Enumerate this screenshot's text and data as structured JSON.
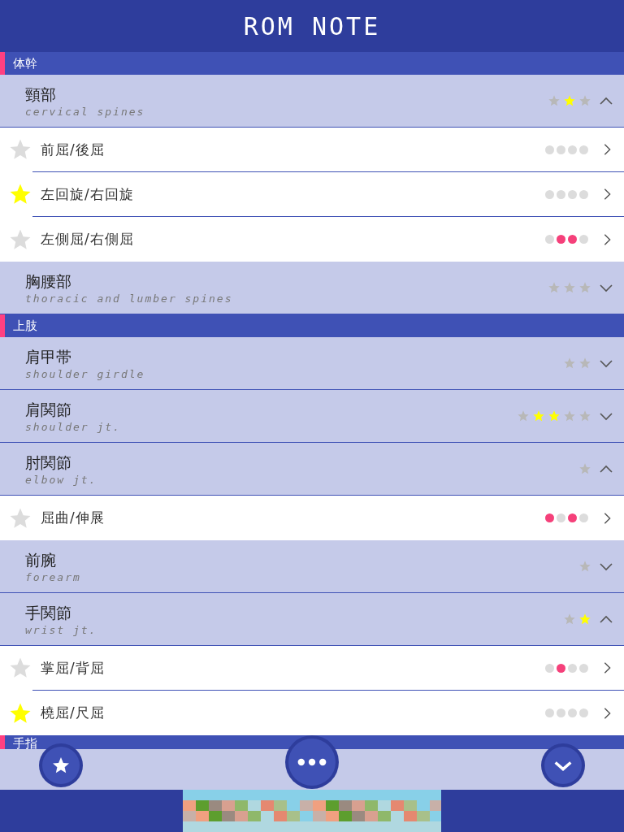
{
  "app_bar": {
    "title": "ROM NOTE"
  },
  "sections": [
    {
      "title": "体幹",
      "groups": [
        {
          "title": "頸部",
          "subtitle": "cervical spines",
          "expanded": true,
          "rating": [
            {
              "on": false
            },
            {
              "on": true
            },
            {
              "on": false
            }
          ],
          "items": [
            {
              "label": "前屈/後屈",
              "favorite": false,
              "dots": [
                {
                  "on": false
                },
                {
                  "on": false
                },
                {
                  "on": false
                },
                {
                  "on": false
                }
              ]
            },
            {
              "label": "左回旋/右回旋",
              "favorite": true,
              "dots": [
                {
                  "on": false
                },
                {
                  "on": false
                },
                {
                  "on": false
                },
                {
                  "on": false
                }
              ]
            },
            {
              "label": "左側屈/右側屈",
              "favorite": false,
              "dots": [
                {
                  "on": false
                },
                {
                  "on": true
                },
                {
                  "on": true
                },
                {
                  "on": false
                }
              ]
            }
          ]
        },
        {
          "title": "胸腰部",
          "subtitle": "thoracic and lumber spines",
          "expanded": false,
          "rating": [
            {
              "on": false
            },
            {
              "on": false
            },
            {
              "on": false
            }
          ]
        }
      ]
    },
    {
      "title": "上肢",
      "groups": [
        {
          "title": "肩甲帯",
          "subtitle": "shoulder girdle",
          "expanded": false,
          "rating": [
            {
              "on": false
            },
            {
              "on": false
            }
          ]
        },
        {
          "title": "肩関節",
          "subtitle": "shoulder jt.",
          "expanded": false,
          "rating": [
            {
              "on": false
            },
            {
              "on": true
            },
            {
              "on": true
            },
            {
              "on": false
            },
            {
              "on": false
            }
          ]
        },
        {
          "title": "肘関節",
          "subtitle": "elbow jt.",
          "expanded": true,
          "rating": [
            {
              "on": false
            }
          ],
          "items": [
            {
              "label": "屈曲/伸展",
              "favorite": false,
              "dots": [
                {
                  "on": true
                },
                {
                  "on": false
                },
                {
                  "on": true
                },
                {
                  "on": false
                }
              ]
            }
          ]
        },
        {
          "title": "前腕",
          "subtitle": "forearm",
          "expanded": false,
          "rating": [
            {
              "on": false
            }
          ]
        },
        {
          "title": "手関節",
          "subtitle": "wrist jt.",
          "expanded": true,
          "rating": [
            {
              "on": false
            },
            {
              "on": true
            }
          ],
          "items": [
            {
              "label": "掌屈/背屈",
              "favorite": false,
              "dots": [
                {
                  "on": false
                },
                {
                  "on": true
                },
                {
                  "on": false
                },
                {
                  "on": false
                }
              ]
            },
            {
              "label": "橈屈/尺屈",
              "favorite": true,
              "dots": [
                {
                  "on": false
                },
                {
                  "on": false
                },
                {
                  "on": false
                },
                {
                  "on": false
                }
              ]
            }
          ]
        }
      ]
    },
    {
      "title": "手指"
    }
  ]
}
